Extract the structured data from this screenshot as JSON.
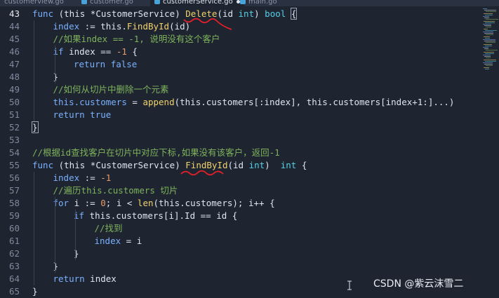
{
  "tabs": [
    {
      "label": "customerview.go"
    },
    {
      "label": "customer.go"
    },
    {
      "label": "customerService.go"
    },
    {
      "label": "main.go"
    }
  ],
  "lines": [
    {
      "num": "43",
      "indent": 0,
      "segs": [
        [
          "kw",
          "func"
        ],
        [
          "tx",
          " (this *CustomerService) "
        ],
        [
          "fn",
          "Delete"
        ],
        [
          "tx",
          "(id "
        ],
        [
          "ty",
          "int"
        ],
        [
          "tx",
          ") "
        ],
        [
          "ty",
          "bool"
        ],
        [
          "tx",
          " "
        ],
        [
          "bx",
          "{"
        ]
      ]
    },
    {
      "num": "44",
      "indent": 1,
      "segs": [
        [
          "kw",
          "index"
        ],
        [
          "tx",
          " := this."
        ],
        [
          "fn",
          "FindById"
        ],
        [
          "tx",
          "(id)"
        ]
      ]
    },
    {
      "num": "45",
      "indent": 1,
      "segs": [
        [
          "cm",
          "//如果index == -1, 说明没有这个客户"
        ]
      ]
    },
    {
      "num": "46",
      "indent": 1,
      "segs": [
        [
          "kw",
          "if"
        ],
        [
          "tx",
          " index == "
        ],
        [
          "nm",
          "-1"
        ],
        [
          "tx",
          " {"
        ]
      ]
    },
    {
      "num": "47",
      "indent": 2,
      "segs": [
        [
          "kw",
          "return"
        ],
        [
          "tx",
          " "
        ],
        [
          "kw",
          "false"
        ]
      ]
    },
    {
      "num": "48",
      "indent": 1,
      "segs": [
        [
          "tx",
          "}"
        ]
      ]
    },
    {
      "num": "49",
      "indent": 1,
      "segs": [
        [
          "cm",
          "//如何从切片中删除一个元素"
        ]
      ]
    },
    {
      "num": "50",
      "indent": 1,
      "segs": [
        [
          "kw",
          "this.customers"
        ],
        [
          "tx",
          " = "
        ],
        [
          "fn",
          "append"
        ],
        [
          "tx",
          "(this.customers[:index], this.customers[index+1:]...)"
        ]
      ]
    },
    {
      "num": "51",
      "indent": 1,
      "segs": [
        [
          "kw",
          "return"
        ],
        [
          "tx",
          " "
        ],
        [
          "kw",
          "true"
        ]
      ]
    },
    {
      "num": "52",
      "indent": 0,
      "segs": [
        [
          "bx",
          "}"
        ]
      ]
    },
    {
      "num": "53",
      "indent": 0,
      "segs": []
    },
    {
      "num": "54",
      "indent": 0,
      "segs": [
        [
          "cm",
          "//根据id查找客户在切片中对应下标,如果没有该客户，返回-1"
        ]
      ]
    },
    {
      "num": "55",
      "indent": 0,
      "segs": [
        [
          "kw",
          "func"
        ],
        [
          "tx",
          " (this *CustomerService) "
        ],
        [
          "fn",
          "FindById"
        ],
        [
          "tx",
          "(id "
        ],
        [
          "ty",
          "int"
        ],
        [
          "tx",
          ")  "
        ],
        [
          "ty",
          "int"
        ],
        [
          "tx",
          " {"
        ]
      ]
    },
    {
      "num": "56",
      "indent": 1,
      "segs": [
        [
          "kw",
          "index"
        ],
        [
          "tx",
          " := "
        ],
        [
          "nm",
          "-1"
        ]
      ]
    },
    {
      "num": "57",
      "indent": 1,
      "segs": [
        [
          "cm",
          "//遍历this.customers 切片"
        ]
      ]
    },
    {
      "num": "58",
      "indent": 1,
      "segs": [
        [
          "kw",
          "for"
        ],
        [
          "tx",
          " i := "
        ],
        [
          "nm",
          "0"
        ],
        [
          "tx",
          "; i < "
        ],
        [
          "fn",
          "len"
        ],
        [
          "tx",
          "(this.customers); i++ {"
        ]
      ]
    },
    {
      "num": "59",
      "indent": 2,
      "segs": [
        [
          "kw",
          "if"
        ],
        [
          "tx",
          " this.customers[i].Id == id {"
        ]
      ]
    },
    {
      "num": "60",
      "indent": 3,
      "segs": [
        [
          "cm",
          "//找到"
        ]
      ]
    },
    {
      "num": "61",
      "indent": 3,
      "segs": [
        [
          "kw",
          "index"
        ],
        [
          "tx",
          " = i"
        ]
      ]
    },
    {
      "num": "62",
      "indent": 2,
      "segs": [
        [
          "tx",
          "}"
        ]
      ]
    },
    {
      "num": "63",
      "indent": 1,
      "segs": [
        [
          "tx",
          "}"
        ]
      ]
    },
    {
      "num": "64",
      "indent": 1,
      "segs": [
        [
          "kw",
          "return"
        ],
        [
          "tx",
          " index"
        ]
      ]
    },
    {
      "num": "65",
      "indent": 0,
      "segs": [
        [
          "tx",
          "}"
        ]
      ]
    }
  ],
  "watermark": "CSDN @紫云沫雪二",
  "icons": {
    "cursor": "text-cursor-icon",
    "tab_file": "go-file-icon",
    "modified": "unsaved-dot-icon"
  },
  "colors": {
    "keyword": "#7bb1ff",
    "function": "#f2d36b",
    "type": "#56d0e6",
    "comment": "#7fb45c",
    "number": "#e89b6a",
    "annotation": "#e0202a"
  }
}
